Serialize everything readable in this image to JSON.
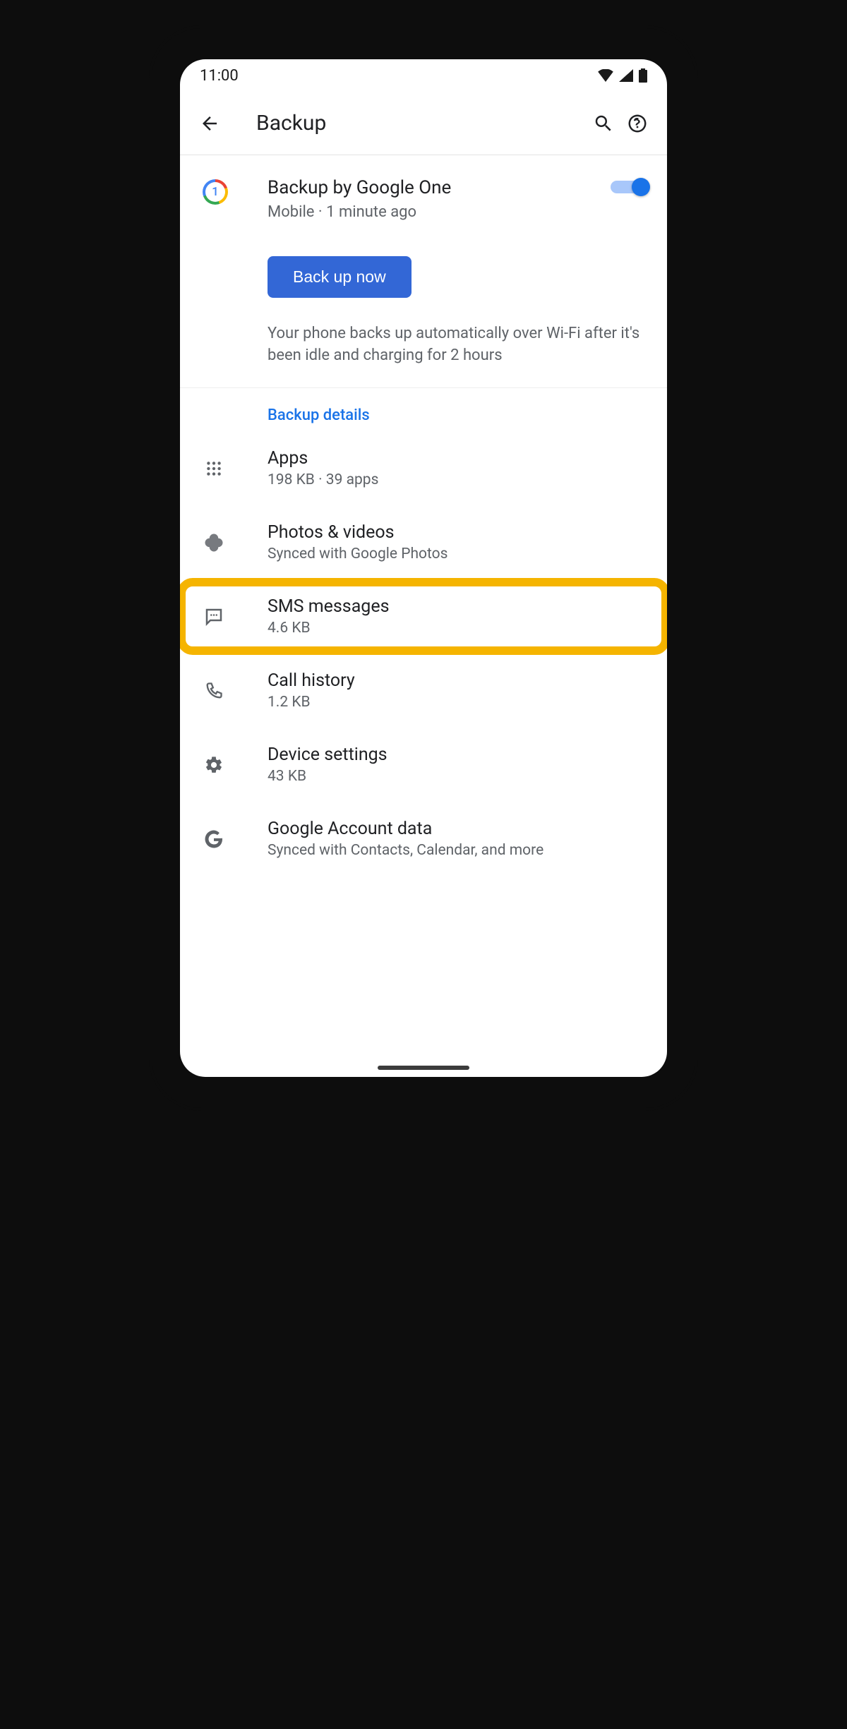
{
  "statusbar": {
    "time": "11:00"
  },
  "appbar": {
    "title": "Backup"
  },
  "backup_row": {
    "title": "Backup by Google One",
    "subtitle": "Mobile · 1 minute ago"
  },
  "backup_button": "Back up now",
  "info": "Your phone backs up automatically over Wi-Fi after it's been idle and charging for 2 hours",
  "section_header": "Backup details",
  "details": {
    "apps": {
      "title": "Apps",
      "sub": "198 KB · 39 apps"
    },
    "photos": {
      "title": "Photos & videos",
      "sub": "Synced with Google Photos"
    },
    "sms": {
      "title": "SMS messages",
      "sub": "4.6 KB"
    },
    "calls": {
      "title": "Call history",
      "sub": "1.2 KB"
    },
    "device": {
      "title": "Device settings",
      "sub": "43 KB"
    },
    "account": {
      "title": "Google Account data",
      "sub": "Synced with Contacts, Calendar, and more"
    }
  }
}
